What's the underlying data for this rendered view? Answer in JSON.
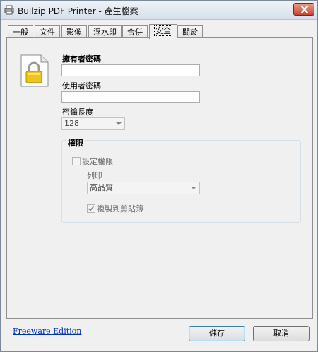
{
  "window": {
    "title": "Bullzip PDF Printer - 產生檔案",
    "icon": "printer-icon",
    "close_icon": "close-icon"
  },
  "tabs": [
    {
      "label": "一般"
    },
    {
      "label": "文件"
    },
    {
      "label": "影像"
    },
    {
      "label": "浮水印"
    },
    {
      "label": "合併"
    },
    {
      "label": "安全",
      "active": true
    },
    {
      "label": "關於"
    }
  ],
  "security": {
    "icon": "lock-icon",
    "owner_password_label": "擁有者密碼",
    "owner_password_value": "",
    "user_password_label": "使用者密碼",
    "user_password_value": "",
    "key_length_label": "密鑰長度",
    "key_length_value": "128",
    "permissions": {
      "group_label": "權限",
      "set_permissions_label": "設定權限",
      "set_permissions_checked": false,
      "print_label": "列印",
      "print_value": "高品質",
      "copy_label": "複製到剪貼簿",
      "copy_checked": true
    }
  },
  "footer": {
    "edition_link": "Freeware Edition",
    "save_label": "儲存",
    "cancel_label": "取消"
  }
}
